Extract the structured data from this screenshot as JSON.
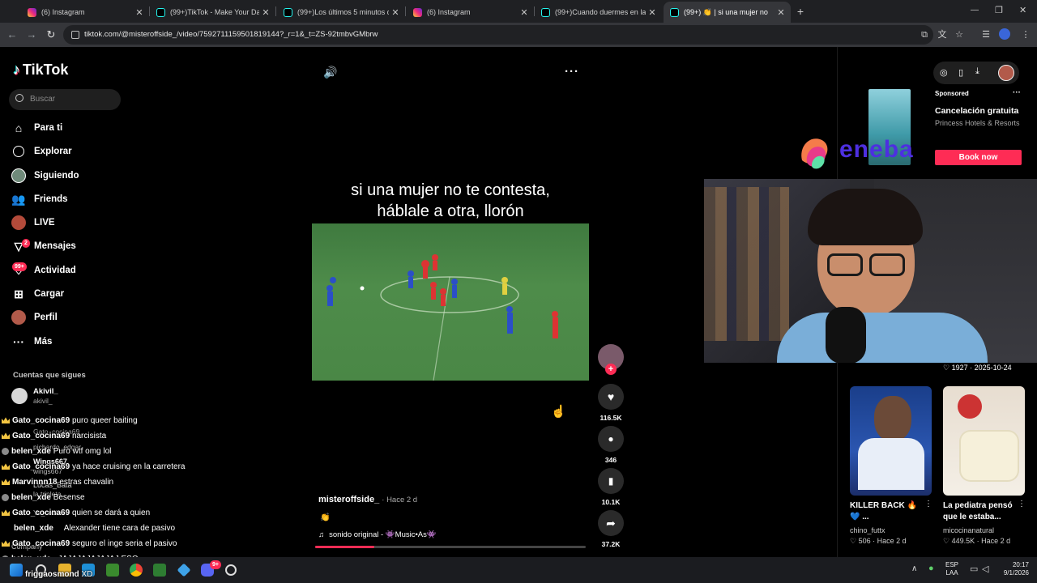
{
  "browser": {
    "tabs": [
      {
        "title": "(6) Instagram",
        "color": "#e1306c"
      },
      {
        "title": "(99+)TikTok - Make Your Day",
        "color": "#111111"
      },
      {
        "title": "(99+)Los últimos 5 minutos de",
        "color": "#111111"
      },
      {
        "title": "(6) Instagram",
        "color": "#e1306c"
      },
      {
        "title": "(99+)Cuando duermes en la ca",
        "color": "#111111"
      },
      {
        "title": "(99+) 👏 | si una mujer no",
        "color": "#111111"
      }
    ],
    "url": "tiktok.com/@misteroffside_/video/7592711159501819144?_r=1&_t=ZS-92tmbvGMbrw",
    "new_tab": "+",
    "window_controls": {
      "minimize": "—",
      "maximize": "❐",
      "close": "✕"
    }
  },
  "sidebar": {
    "logo": "TikTok",
    "search_placeholder": "Buscar",
    "items": [
      {
        "label": "Para ti",
        "icon": "home-icon"
      },
      {
        "label": "Explorar",
        "icon": "compass-icon"
      },
      {
        "label": "Siguiendo",
        "icon": "following-icon"
      },
      {
        "label": "Friends",
        "icon": "friends-icon"
      },
      {
        "label": "LIVE",
        "icon": "live-icon"
      },
      {
        "label": "Mensajes",
        "icon": "messages-icon",
        "badge": "2"
      },
      {
        "label": "Actividad",
        "icon": "activity-icon",
        "badge": "99+"
      },
      {
        "label": "Cargar",
        "icon": "upload-icon"
      },
      {
        "label": "Perfil",
        "icon": "profile-icon"
      },
      {
        "label": "Más",
        "icon": "more-icon"
      }
    ],
    "following_title": "Cuentas que sigues",
    "following_top": {
      "name": "Akivil_",
      "handle": "akivil_"
    },
    "company_label": "Company"
  },
  "chat": [
    {
      "user": "Gato_cocina69",
      "msg": "puro queer baiting",
      "badge": "crown"
    },
    {
      "user": "Gato_cocina69",
      "msg": "narcisista",
      "badge": "crown"
    },
    {
      "user": "belen_xde",
      "msg": "Puro wtf omg lol",
      "badge": "cat"
    },
    {
      "user": "Gato_cocina69",
      "msg": "ya hace cruising en la carretera",
      "badge": "crown"
    },
    {
      "user": "Marvinnn18",
      "msg": "estras chavalin",
      "badge": "crown"
    },
    {
      "user": "belen_xde",
      "msg": "Besense",
      "badge": "cat"
    },
    {
      "user": "Gato_cocina69",
      "msg": "quien se dará a quien",
      "badge": "crown"
    },
    {
      "user": "belen_xde",
      "msg": "Alexander tiene cara de pasivo",
      "badge": "none"
    },
    {
      "user": "Gato_cocina69",
      "msg": "seguro el inge seria el pasivo",
      "badge": "crown"
    },
    {
      "user": "belen_xde",
      "msg": "JAJAJAJAJAJAJ ESO",
      "badge": "cat"
    },
    {
      "user": "friggaosmond",
      "msg": "XD",
      "badge": "none"
    }
  ],
  "ghost_following": [
    "Gato_cocina69",
    "pichardo_edgar",
    "Wings667",
    "wings667",
    "Lucas_Bata",
    "la.tripleta",
    "Yo_cocina"
  ],
  "video": {
    "caption_line1": "si una mujer no te contesta,",
    "caption_line2": "háblale a otra, llorón",
    "author": "misteroffside_",
    "time": "· Hace 2 d",
    "emoji": "👏",
    "sound": "sonido original - 👾Music•As👾",
    "progress": 0.22,
    "likes": "116.5K",
    "comments": "346",
    "saves": "10.1K",
    "shares": "37.2K"
  },
  "ad": {
    "sponsored": "Sponsored",
    "title": "Cancelación gratuita",
    "advertiser": "Princess Hotels & Resorts",
    "cta": "Book now",
    "overlay_logo": "eneba"
  },
  "stats": {
    "likes": "1927",
    "date": "2025-10-24"
  },
  "cards": [
    {
      "title": "KILLER BACK 🔥 💙 ...",
      "author": "chino_futtx",
      "views": "506",
      "time": "Hace 2 d"
    },
    {
      "title": "La pediatra pensó que le estaba...",
      "author": "micocinanatural",
      "views": "449.5K",
      "time": "Hace 2 d"
    }
  ],
  "taskbar": {
    "lang": "ESP",
    "layout": "LAA",
    "time": "20:17",
    "date": "9/1/2026",
    "badge": "9+"
  },
  "colors": {
    "accent": "#fe2c55",
    "eneba": "#4d2fe0"
  }
}
